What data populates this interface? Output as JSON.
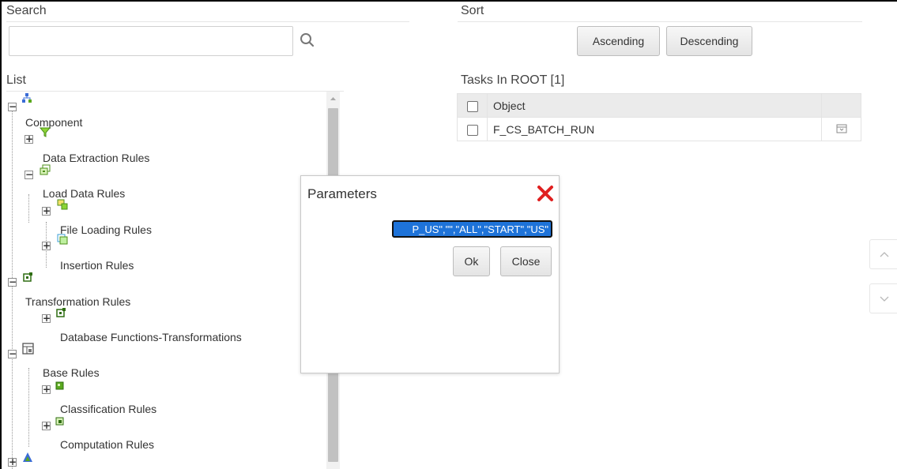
{
  "search": {
    "label": "Search",
    "value": "",
    "placeholder": ""
  },
  "sort": {
    "label": "Sort",
    "ascending": "Ascending",
    "descending": "Descending"
  },
  "list": {
    "label": "List",
    "items": [
      {
        "label": "Component",
        "icon": "hierarchy-root-icon",
        "expander": "−"
      },
      {
        "label": "Data Extraction Rules",
        "icon": "funnel-icon",
        "expander": "+"
      },
      {
        "label": "Load Data Rules",
        "icon": "load-data-icon",
        "expander": "−"
      },
      {
        "label": "File Loading Rules",
        "icon": "file-loading-icon",
        "expander": "+"
      },
      {
        "label": "Insertion Rules",
        "icon": "insertion-icon",
        "expander": "+"
      },
      {
        "label": "Transformation Rules",
        "icon": "transformation-icon",
        "expander": "−"
      },
      {
        "label": "Database Functions-Transformations",
        "icon": "db-function-icon",
        "expander": "+"
      },
      {
        "label": "Base Rules",
        "icon": "base-rules-icon",
        "expander": "−"
      },
      {
        "label": "Classification Rules",
        "icon": "classification-icon",
        "expander": "+"
      },
      {
        "label": "Computation Rules",
        "icon": "computation-icon",
        "expander": "+"
      },
      {
        "label": "",
        "icon": "triangle-icon",
        "expander": "+"
      }
    ]
  },
  "tasks": {
    "label": "Tasks In ROOT [1]",
    "header": "Object",
    "rows": [
      {
        "object": "F_CS_BATCH_RUN",
        "action_icon": "drawer-icon"
      }
    ]
  },
  "dialog": {
    "title": "Parameters",
    "value": "P_US\",\"\",\"ALL\",\"START\",\"US\"",
    "ok": "Ok",
    "close": "Close"
  },
  "colors": {
    "accent_blue": "#1e73d9",
    "close_red": "#e02020",
    "icon_green": "#5aa81e"
  }
}
